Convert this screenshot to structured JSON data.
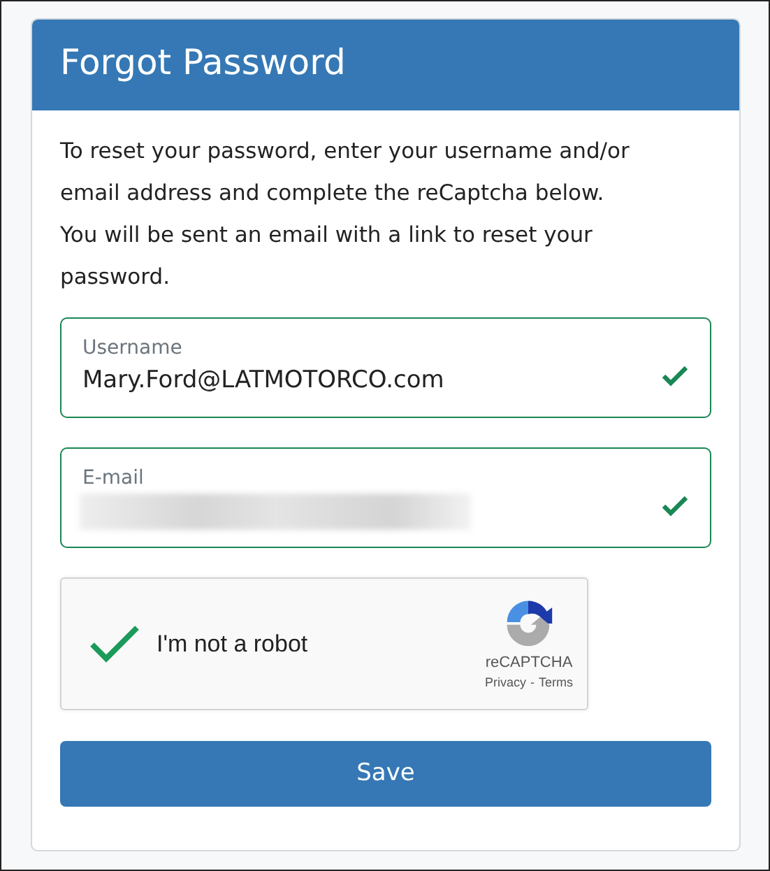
{
  "card": {
    "title": "Forgot Password"
  },
  "instructions": [
    "To reset your password, enter your username and/or",
    "email address and complete the reCaptcha below.",
    "You will be sent an email with a link to reset your",
    "password."
  ],
  "fields": [
    {
      "label": "Username",
      "value": "Mary.Ford@LATMOTORCO.com",
      "valid": true
    },
    {
      "label": "E-mail",
      "redacted": true,
      "valid": true
    }
  ],
  "captcha": {
    "checked": true,
    "label": "I'm not a robot",
    "brand": "reCAPTCHA",
    "links": [
      "Privacy",
      "Terms"
    ],
    "separator": "-"
  },
  "buttons": [
    "Save"
  ]
}
